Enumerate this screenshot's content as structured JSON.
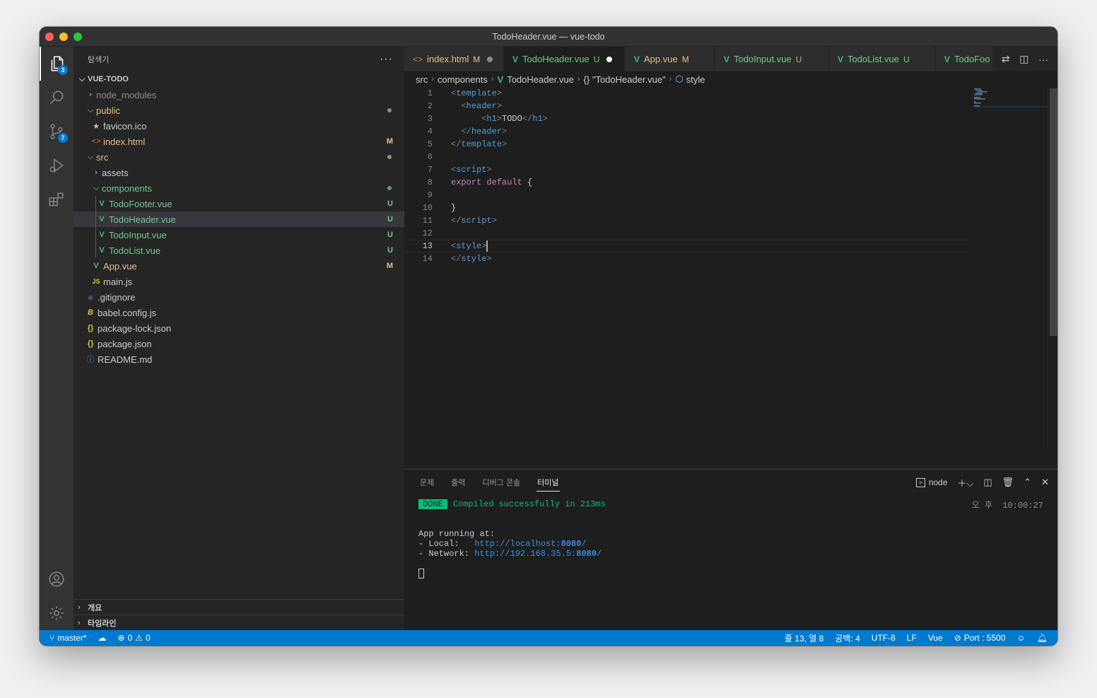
{
  "window": {
    "title": "TodoHeader.vue — vue-todo"
  },
  "activity": {
    "explorer_badge": "3",
    "scm_badge": "7"
  },
  "sidebar": {
    "title": "탐색기",
    "more": "···",
    "root": "VUE-TODO",
    "items": [
      {
        "label": "node_modules",
        "status": ""
      },
      {
        "label": "public",
        "status": "●"
      },
      {
        "label": "favicon.ico",
        "status": ""
      },
      {
        "label": "index.html",
        "status": "M"
      },
      {
        "label": "src",
        "status": "●"
      },
      {
        "label": "assets",
        "status": ""
      },
      {
        "label": "components",
        "status": "●"
      },
      {
        "label": "TodoFooter.vue",
        "status": "U"
      },
      {
        "label": "TodoHeader.vue",
        "status": "U"
      },
      {
        "label": "TodoInput.vue",
        "status": "U"
      },
      {
        "label": "TodoList.vue",
        "status": "U"
      },
      {
        "label": "App.vue",
        "status": "M"
      },
      {
        "label": "main.js",
        "status": ""
      },
      {
        "label": ".gitignore",
        "status": ""
      },
      {
        "label": "babel.config.js",
        "status": ""
      },
      {
        "label": "package-lock.json",
        "status": ""
      },
      {
        "label": "package.json",
        "status": ""
      },
      {
        "label": "README.md",
        "status": ""
      }
    ],
    "sections": [
      "개요",
      "타임라인"
    ]
  },
  "tabs": [
    {
      "label": "index.html",
      "status": "M"
    },
    {
      "label": "TodoHeader.vue",
      "status": "U"
    },
    {
      "label": "App.vue",
      "status": "M"
    },
    {
      "label": "TodoInput.vue",
      "status": "U"
    },
    {
      "label": "TodoList.vue",
      "status": "U"
    },
    {
      "label": "TodoFoo",
      "status": ""
    }
  ],
  "breadcrumb": {
    "src": "src",
    "components": "components",
    "file": "TodoHeader.vue",
    "obj": "{} \"TodoHeader.vue\"",
    "style": "style"
  },
  "code": {
    "lines": [
      "1",
      "2",
      "3",
      "4",
      "5",
      "6",
      "7",
      "8",
      "9",
      "10",
      "11",
      "12",
      "13",
      "14"
    ],
    "h1_text": "TODO",
    "kw_export": "export",
    "kw_default": "default"
  },
  "panel": {
    "tabs": [
      "문제",
      "출력",
      "디버그 콘솔",
      "터미널"
    ],
    "terminal_name": "node",
    "done": "DONE",
    "compiled": "Compiled successfully in 213ms",
    "time": "오 후  10:00:27",
    "running": "App running at:",
    "local_label": "- Local:   ",
    "local_url": "http://localhost:",
    "local_port": "8080",
    "network_label": "- Network: ",
    "network_url": "http://192.168.35.5:",
    "network_port": "8080"
  },
  "status": {
    "branch": "master*",
    "errors": "0",
    "warnings": "0",
    "position": "줄 13, 열 8",
    "spaces": "공백: 4",
    "encoding": "UTF-8",
    "eol": "LF",
    "language": "Vue",
    "port": "Port : 5500"
  },
  "colors": {
    "accent": "#007acc",
    "modified": "#e2c08d",
    "untracked": "#73c991",
    "vue": "#42b883"
  }
}
